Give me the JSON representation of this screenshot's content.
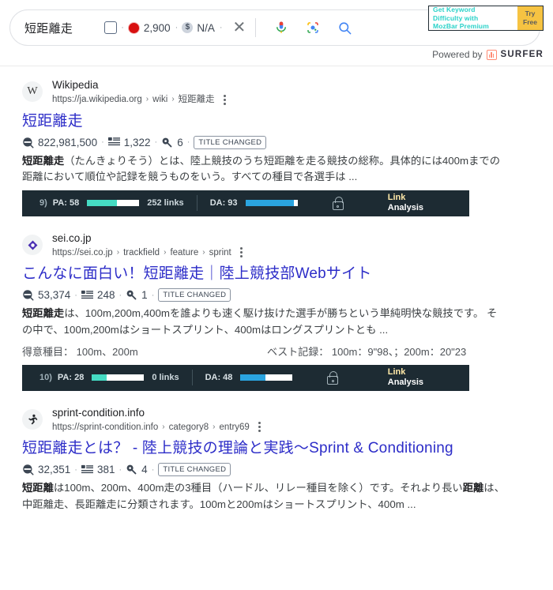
{
  "topbar": {
    "query": "短距離走",
    "chips": {
      "checkbox_icon": "square-outline-icon",
      "volume_icon": "red-dot-icon",
      "volume_value": "2,900",
      "cpc_icon": "dollar-icon",
      "cpc_symbol": "$",
      "cpc_value": "N/A",
      "separator": "·"
    },
    "close_label": "✕",
    "voice_icon": "microphone-icon",
    "lens_icon": "google-lens-icon",
    "search_icon": "magnifier-icon",
    "promo": {
      "line1": "Get Keyword",
      "line2": "Difficulty with",
      "line3": "MozBar Premium",
      "button_line1": "Try",
      "button_line2": "Free",
      "text_color": "#2ad2c9",
      "button_color": "#f6c342"
    },
    "powered_by": {
      "prefix": "Powered by",
      "brand": "SURFER"
    }
  },
  "results": [
    {
      "favicon": "wikipedia-w-icon",
      "favicon_text": "W",
      "site_name": "Wikipedia",
      "url_parts": [
        "https://ja.wikipedia.org",
        "wiki",
        "短距離走"
      ],
      "title": "短距離走",
      "metrics": {
        "volume_icon": "search-volume-icon",
        "volume": "822,981,500",
        "links_icon": "list-icon",
        "links": "1,322",
        "keyword_icon": "key-icon",
        "keywords": "6",
        "badge": "TITLE CHANGED"
      },
      "snippet_bold": "短距離走",
      "snippet": "（たんきょりそう）とは、陸上競技のうち短距離を走る競技の総称。具体的には400mまでの距離において順位や記録を競うものをいう。すべての種目で各選手は ...",
      "mozbar": {
        "rank": "9)",
        "pa_label": "PA: 58",
        "pa_value": 58,
        "links": "252 links",
        "da_label": "DA: 93",
        "da_value": 93,
        "lock_icon": "lock-icon",
        "link_analysis_line1": "Link",
        "link_analysis_line2": "Analysis"
      }
    },
    {
      "favicon": "sei-diamond-icon",
      "favicon_text": "",
      "site_name": "sei.co.jp",
      "url_parts": [
        "https://sei.co.jp",
        "trackfield",
        "feature",
        "sprint"
      ],
      "title": "こんなに面白い！短距離走｜陸上競技部Webサイト",
      "metrics": {
        "volume_icon": "search-volume-icon",
        "volume": "53,374",
        "links_icon": "list-icon",
        "links": "248",
        "keyword_icon": "key-icon",
        "keywords": "1",
        "badge": "TITLE CHANGED"
      },
      "snippet_bold": "短距離走",
      "snippet": "は、100m,200m,400mを誰よりも速く駆け抜けた選手が勝ちという単純明快な競技です。 その中で、100m,200mはショートスプリント、400mはロングスプリントとも ...",
      "rich_left": "得意種目： 100m、200m",
      "rich_right": "ベスト記録： 100m：9\"98、；200m：20\"23",
      "mozbar": {
        "rank": "10)",
        "pa_label": "PA: 28",
        "pa_value": 28,
        "links": "0 links",
        "da_label": "DA: 48",
        "da_value": 48,
        "lock_icon": "lock-icon",
        "link_analysis_line1": "Link",
        "link_analysis_line2": "Analysis"
      }
    },
    {
      "favicon": "runner-icon",
      "favicon_text": "",
      "site_name": "sprint-condition.info",
      "url_parts": [
        "https://sprint-condition.info",
        "category8",
        "entry69"
      ],
      "title": "短距離走とは？ - 陸上競技の理論と実践〜Sprint & Conditioning",
      "metrics": {
        "volume_icon": "search-volume-icon",
        "volume": "32,351",
        "links_icon": "list-icon",
        "links": "381",
        "keyword_icon": "key-icon",
        "keywords": "4",
        "badge": "TITLE CHANGED"
      },
      "snippet_bold": "短距離",
      "snippet": "は100m、200m、400m走の3種目（ハードル、リレー種目を除く）です。それより長い",
      "snippet_bold2": "距離",
      "snippet2": "は、中距離走、長距離走に分類されます。100mと200mはショートスプリント、400m ..."
    }
  ]
}
